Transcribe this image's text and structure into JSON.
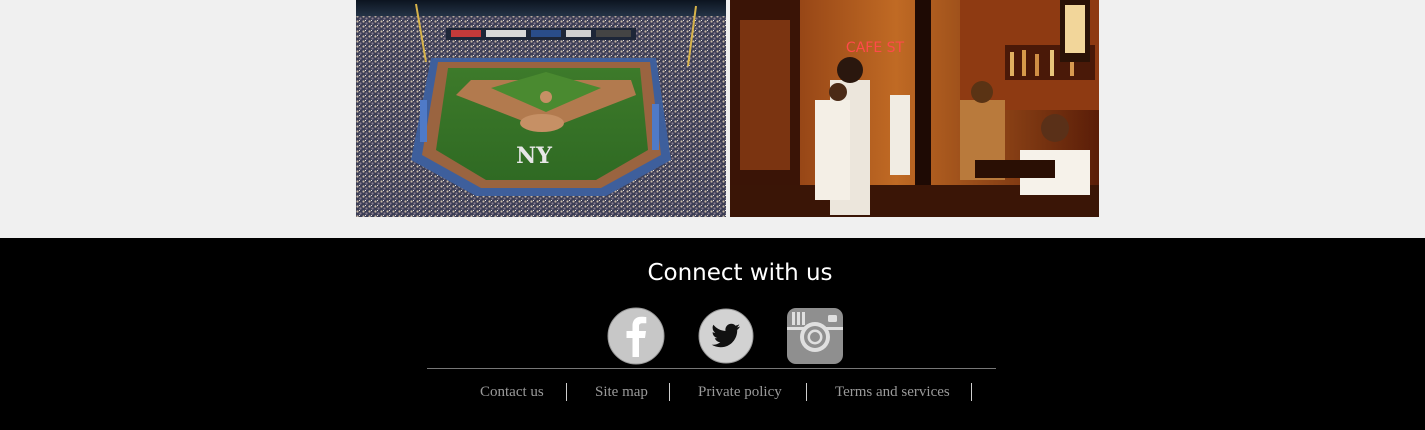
{
  "footer": {
    "title": "Connect with us",
    "social": [
      {
        "name": "facebook",
        "icon": "facebook-icon"
      },
      {
        "name": "twitter",
        "icon": "twitter-icon"
      },
      {
        "name": "instagram",
        "icon": "instagram-icon"
      }
    ],
    "links": [
      "Contact us",
      "Site map",
      "Private policy",
      "Terms and services"
    ]
  },
  "photos": {
    "left": "stadium-photo",
    "right": "restaurant-photo",
    "restaurant_sign": "CAFE ST"
  },
  "colors": {
    "footer_bg": "#000000",
    "page_bg": "#f0f0f0",
    "link_text": "#9a9a9a",
    "social_icon": "#c7c7c7"
  }
}
